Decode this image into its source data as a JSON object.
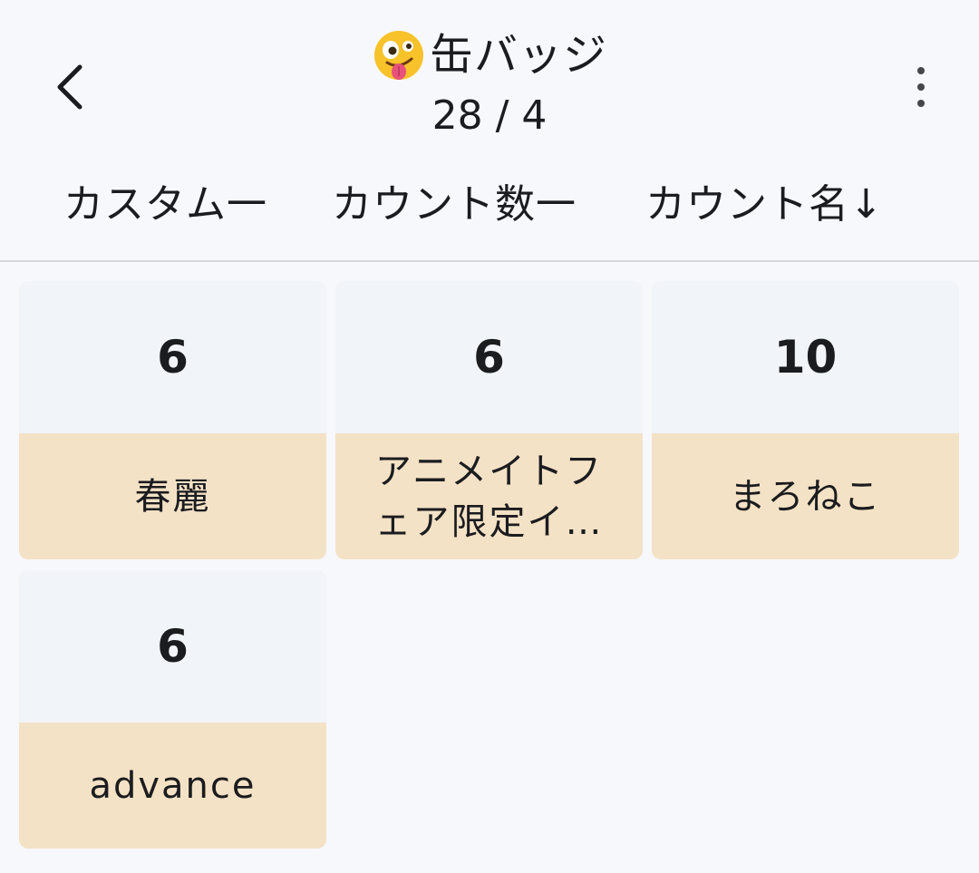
{
  "header": {
    "back_icon": "chevron-left-icon",
    "title_emoji": "zany-face-emoji",
    "title": "缶バッジ",
    "subtitle": "28 / 4",
    "more_icon": "more-vert-icon"
  },
  "sort_options": [
    {
      "label": "カスタム一"
    },
    {
      "label": "カウント数一"
    },
    {
      "label": "カウント名↓"
    }
  ],
  "cards": [
    {
      "count": "6",
      "name": "春麗"
    },
    {
      "count": "6",
      "name": "アニメイトフェア限定イ…"
    },
    {
      "count": "10",
      "name": "まろねこ"
    },
    {
      "count": "6",
      "name": "advance"
    }
  ],
  "colors": {
    "background": "#f7f8fc",
    "card_top": "#f1f4f8",
    "card_bottom": "#f4e2c6",
    "text": "#1b1c1f"
  }
}
